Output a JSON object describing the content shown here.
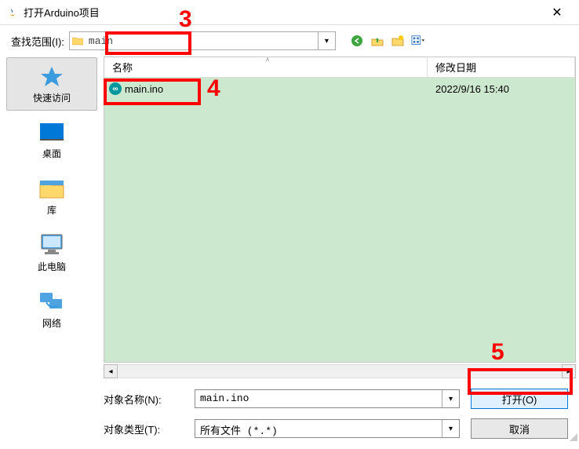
{
  "window": {
    "title": "打开Arduino项目",
    "close": "✕"
  },
  "lookin": {
    "label": "查找范围(I):",
    "value": "main"
  },
  "sidebar": [
    {
      "label": "快速访问",
      "icon": "star"
    },
    {
      "label": "桌面",
      "icon": "desktop"
    },
    {
      "label": "库",
      "icon": "libraries"
    },
    {
      "label": "此电脑",
      "icon": "pc"
    },
    {
      "label": "网络",
      "icon": "network"
    }
  ],
  "headers": {
    "name": "名称",
    "date": "修改日期"
  },
  "files": [
    {
      "name": "main.ino",
      "date": "2022/9/16 15:40"
    }
  ],
  "filename": {
    "label": "对象名称(N):",
    "value": "main.ino"
  },
  "filetype": {
    "label": "对象类型(T):",
    "value": "所有文件 (*.*)"
  },
  "buttons": {
    "open": "打开(O)",
    "cancel": "取消"
  },
  "annotations": {
    "a3": "3",
    "a4": "4",
    "a5": "5"
  }
}
